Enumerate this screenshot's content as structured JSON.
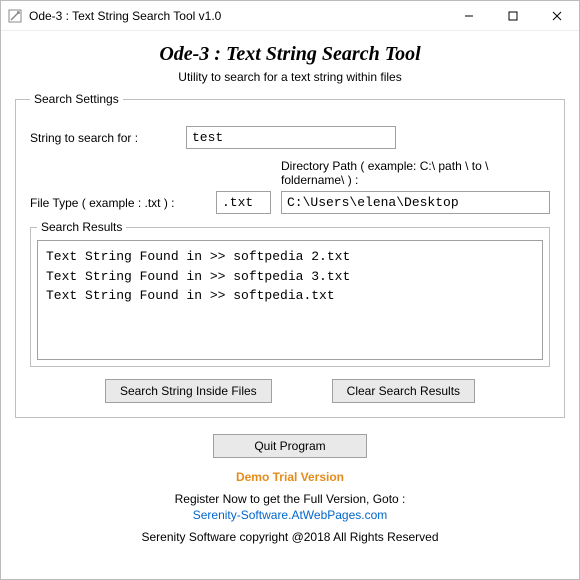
{
  "titlebar": {
    "title": "Ode-3 : Text String Search Tool v1.0"
  },
  "header": {
    "app_title": "Ode-3 : Text String Search Tool",
    "subtitle": "Utility to search for a text string within files"
  },
  "settings": {
    "legend": "Search Settings",
    "string_label": "String to search for  :",
    "string_value": "test",
    "filetype_label": "File Type  ( example : .txt )  :",
    "filetype_value": ".txt",
    "dirpath_label": "Directory Path  ( example: C:\\ path \\ to \\ foldername\\ ) :",
    "dirpath_value": "C:\\Users\\elena\\Desktop"
  },
  "results": {
    "legend": "Search Results",
    "lines": [
      "Text String Found in >> softpedia 2.txt",
      "Text String Found in >> softpedia 3.txt",
      "Text String Found in >> softpedia.txt"
    ]
  },
  "buttons": {
    "search": "Search String Inside Files",
    "clear": "Clear Search Results",
    "quit": "Quit Program"
  },
  "footer": {
    "demo": "Demo Trial Version",
    "register": "Register Now to get the Full Version, Goto :",
    "link": "Serenity-Software.AtWebPages.com",
    "copyright": "Serenity Software copyright @2018 All Rights Reserved"
  }
}
